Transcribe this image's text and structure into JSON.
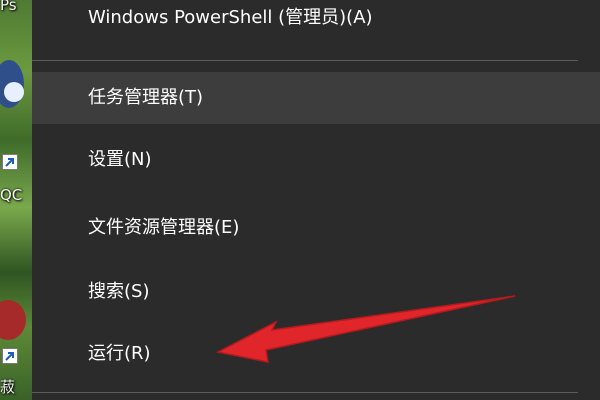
{
  "desktop": {
    "labels": [
      "Ps",
      "QC",
      "菽"
    ],
    "shortcut_icon": "shortcut-arrow-icon",
    "app_icon": "qq-icon"
  },
  "context_menu": {
    "items": [
      {
        "label": "Windows PowerShell (管理员)(A)",
        "hovered": false
      },
      {
        "label": "任务管理器(T)",
        "hovered": true
      },
      {
        "label": "设置(N)",
        "hovered": false
      },
      {
        "label": "文件资源管理器(E)",
        "hovered": false
      },
      {
        "label": "搜索(S)",
        "hovered": false
      },
      {
        "label": "运行(R)",
        "hovered": false
      }
    ],
    "background_color": "#2b2b2b",
    "hover_color": "#3d3d3d",
    "text_color": "#ffffff"
  },
  "annotation": {
    "type": "red-arrow",
    "points_to": "运行(R)",
    "color": "#e0262a"
  }
}
